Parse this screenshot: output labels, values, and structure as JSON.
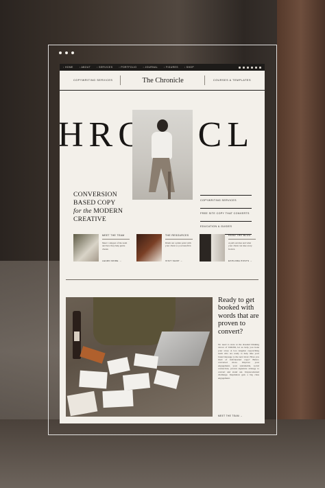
{
  "nav": {
    "items": [
      "HOME",
      "ABOUT",
      "SERVICES",
      "PORTFOLIO",
      "JOURNAL",
      "FIGURES",
      "SHOP"
    ],
    "socials": [
      "facebook-icon",
      "pinterest-icon",
      "twitter-icon",
      "instagram-icon",
      "linkedin-icon",
      "youtube-icon"
    ]
  },
  "header": {
    "left": "COPYWRITING SERVICES",
    "logo": "The Chronicle",
    "right": "COURSES & TEMPLATES"
  },
  "hero": {
    "big_word": "HRONICL",
    "line1": "CONVERSION",
    "line2": "BASED COPY",
    "line3_italic": "for the",
    "line3_rest": " MODERN",
    "line4": "CREATIVE",
    "links": [
      "COPYWRITING SERVICES",
      "FREE SITE COPY THAT CONVERTS",
      "EDUCATION & GUIDES"
    ]
  },
  "cards": [
    {
      "title": "MEET THE TEAM",
      "desc": "Meet 1 snippet of the team and how they help guide clients",
      "link": "LEARN MORE"
    },
    {
      "title": "THE RESOURCES",
      "desc": "Drum out a plain point with your client so you benefit it.",
      "link": "VISIT SHOP"
    },
    {
      "title": "READ THE BLOG",
      "desc": "A pull out idea and what your client can take away from it.",
      "link": "EXPLORE POSTS"
    }
  ],
  "cta": {
    "heading": "Ready to get booked with words that are proven to convert?",
    "body": "No need to stare at the dreaded blinking cursor of DOOM, let us help you hone your story. A Los Angeles copywriting team who are ready to help take your brand message to the next level. Have you tired of half-hearted copy? Better-converted more. Improve your engagement, your sustainable, social connection, proven signature strategy to convert and stand out. Unprecedented challenge. Inspiration gets a big class engagement.",
    "link": "MEET THE TEAM"
  },
  "colors": {
    "accent": "#1d1b19",
    "paper": "#f3f0ea"
  }
}
